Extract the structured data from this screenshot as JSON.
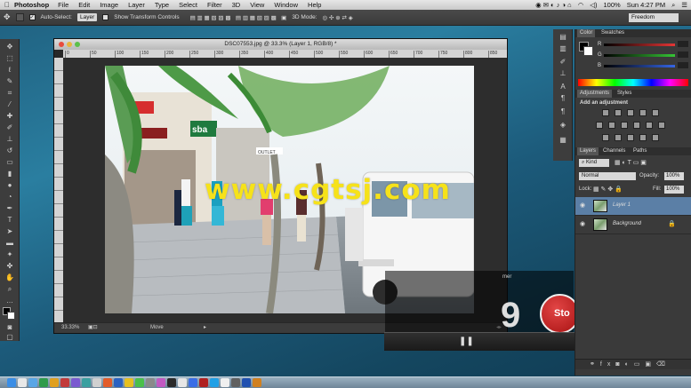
{
  "menubar": {
    "apple": "",
    "app_name": "Photoshop",
    "items": [
      "File",
      "Edit",
      "Image",
      "Layer",
      "Type",
      "Select",
      "Filter",
      "3D",
      "View",
      "Window",
      "Help"
    ],
    "battery": "100%",
    "clock": "Sun 4:27 PM"
  },
  "options_bar": {
    "auto_select_label": "Auto-Select:",
    "auto_select_value": "Layer",
    "show_transform_label": "Show Transform Controls",
    "mode_3d": "3D Mode:",
    "workspace": "Freedom"
  },
  "document": {
    "title": "DSC07553.jpg @ 33.3% (Layer 1, RGB/8) *",
    "zoom": "33.33%",
    "status_tool": "Move",
    "ruler_ticks": [
      "0",
      "50",
      "100",
      "150",
      "200",
      "250",
      "300",
      "350",
      "400",
      "450",
      "500",
      "550",
      "600",
      "650",
      "700",
      "750",
      "800",
      "850"
    ],
    "photo_signs": {
      "shop_sign": "sba",
      "outlet": "OUTLET"
    }
  },
  "color_panel": {
    "tabs": [
      "Color",
      "Swatches"
    ],
    "channels": [
      {
        "label": "R",
        "value": "",
        "color": "#e53535"
      },
      {
        "label": "G",
        "value": "",
        "color": "#35c535"
      },
      {
        "label": "B",
        "value": "",
        "color": "#3565e5"
      }
    ]
  },
  "adjustments_panel": {
    "tabs": [
      "Adjustments",
      "Styles"
    ],
    "hint": "Add an adjustment"
  },
  "layers_panel": {
    "tabs": [
      "Layers",
      "Channels",
      "Paths"
    ],
    "filter": "Kind",
    "blend_mode": "Normal",
    "opacity_label": "Opacity:",
    "opacity_value": "100%",
    "lock_label": "Lock:",
    "fill_label": "Fill:",
    "fill_value": "100%",
    "layers": [
      {
        "name": "Layer 1",
        "selected": true
      },
      {
        "name": "Background",
        "selected": false,
        "locked": true
      }
    ]
  },
  "overlay": {
    "stop_label": "Sto",
    "timer_digit": "9",
    "timer_title": "mer"
  },
  "watermark": "www.cgtsj.com"
}
